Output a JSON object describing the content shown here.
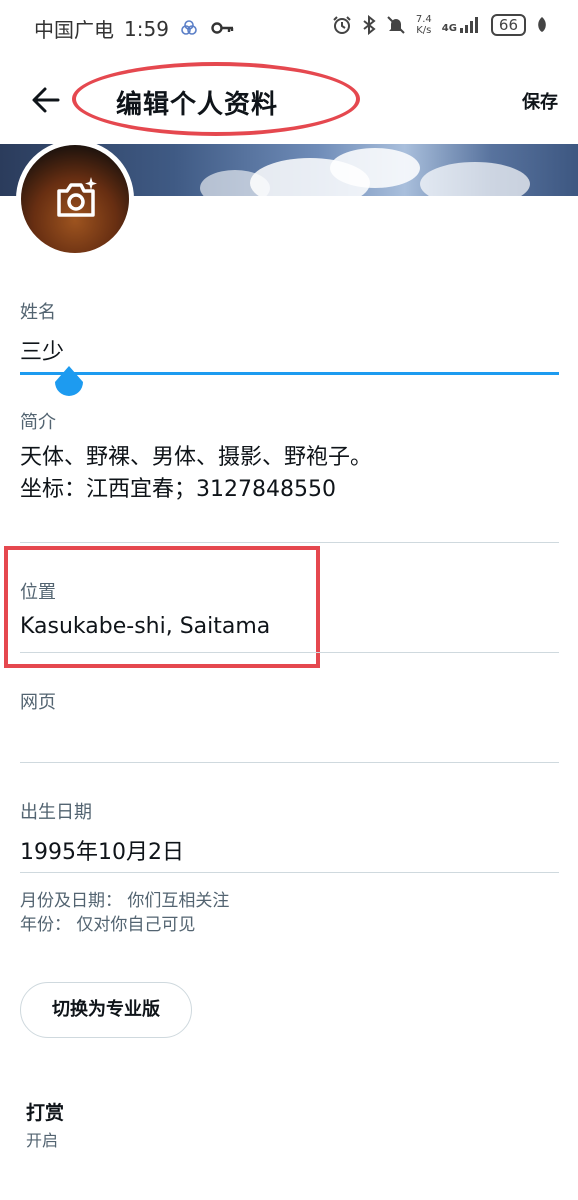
{
  "status_bar": {
    "carrier": "中国广电",
    "time": "1:59",
    "net_speed_value": "7.4",
    "net_speed_unit": "K/s",
    "network": "4G",
    "battery": "66",
    "icons": [
      "alarm-icon",
      "bluetooth-icon",
      "mute-icon",
      "signal-icon",
      "leaf-icon",
      "key-icon",
      "data-saver-icon"
    ]
  },
  "header": {
    "title": "编辑个人资料",
    "save_label": "保存",
    "back_icon": "arrow-left-icon"
  },
  "profile": {
    "camera_icon": "camera-plus-icon"
  },
  "form": {
    "name": {
      "label": "姓名",
      "value": "三少"
    },
    "bio": {
      "label": "简介",
      "line1": "天体、野裸、男体、摄影、野袍子。",
      "line2": "坐标：江西宜春；3127848550"
    },
    "location": {
      "label": "位置",
      "value": "Kasukabe-shi, Saitama"
    },
    "website": {
      "label": "网页",
      "value": ""
    },
    "birthday": {
      "label": "出生日期",
      "value": "1995年10月2日",
      "privacy_month_day": "月份及日期：  你们互相关注",
      "privacy_year": "年份：  仅对你自己可见"
    }
  },
  "actions": {
    "switch_pro_label": "切换为专业版"
  },
  "tips": {
    "title": "打赏",
    "value": "开启"
  },
  "colors": {
    "accent": "#1d9bf0",
    "annotation_red": "#e5484f",
    "divider": "#cfd9de",
    "secondary_text": "#536471"
  }
}
